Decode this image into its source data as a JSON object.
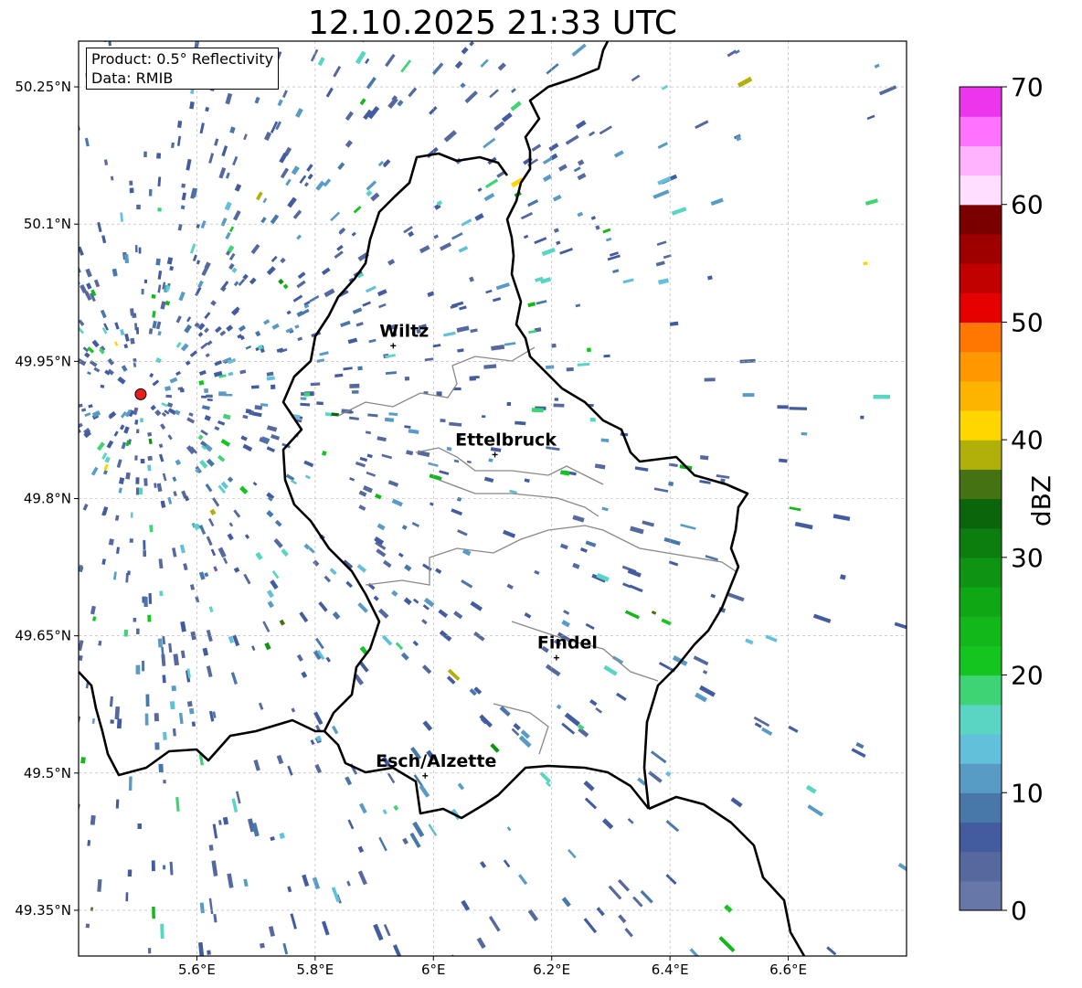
{
  "title": "12.10.2025 21:33 UTC",
  "info": {
    "product": "Product: 0.5° Reflectivity",
    "source": "Data: RMIB"
  },
  "map": {
    "lon_range": [
      5.4,
      6.8
    ],
    "lat_range": [
      49.3,
      50.3
    ],
    "lon_ticks": [
      {
        "value": 5.6,
        "label": "5.6°E"
      },
      {
        "value": 5.8,
        "label": "5.8°E"
      },
      {
        "value": 6.0,
        "label": "6°E"
      },
      {
        "value": 6.2,
        "label": "6.2°E"
      },
      {
        "value": 6.4,
        "label": "6.4°E"
      },
      {
        "value": 6.6,
        "label": "6.6°E"
      }
    ],
    "lat_ticks": [
      {
        "value": 49.35,
        "label": "49.35°N"
      },
      {
        "value": 49.5,
        "label": "49.5°N"
      },
      {
        "value": 49.65,
        "label": "49.65°N"
      },
      {
        "value": 49.8,
        "label": "49.8°N"
      },
      {
        "value": 49.95,
        "label": "49.95°N"
      },
      {
        "value": 50.1,
        "label": "50.1°N"
      },
      {
        "value": 50.25,
        "label": "50.25°N"
      }
    ],
    "grid": true,
    "radar_site": {
      "lon": 5.505,
      "lat": 49.914,
      "color": "#e8201c"
    },
    "cities": [
      {
        "name": "Wiltz",
        "lon": 5.932,
        "lat": 49.967
      },
      {
        "name": "Ettelbruck",
        "lon": 6.104,
        "lat": 49.848
      },
      {
        "name": "Findel",
        "lon": 6.208,
        "lat": 49.626
      },
      {
        "name": "Esch/Alzette",
        "lon": 5.986,
        "lat": 49.497
      }
    ]
  },
  "colorbar": {
    "label": "dBZ",
    "min": 0,
    "max": 70,
    "ticks": [
      0,
      10,
      20,
      30,
      40,
      50,
      60,
      70
    ],
    "colors": [
      "#6777a8",
      "#56699f",
      "#425c9f",
      "#4877aa",
      "#589bc4",
      "#63c0db",
      "#5bd5c3",
      "#3ed474",
      "#14c520",
      "#12b81a",
      "#10a715",
      "#0e9412",
      "#0c7e10",
      "#0a650b",
      "#457312",
      "#afb00a",
      "#ffd600",
      "#fdb400",
      "#ff9700",
      "#ff7700",
      "#e60000",
      "#c10000",
      "#9e0000",
      "#7a0000",
      "#ffdfff",
      "#ffb3ff",
      "#ff72ff",
      "#ec36ee"
    ]
  }
}
